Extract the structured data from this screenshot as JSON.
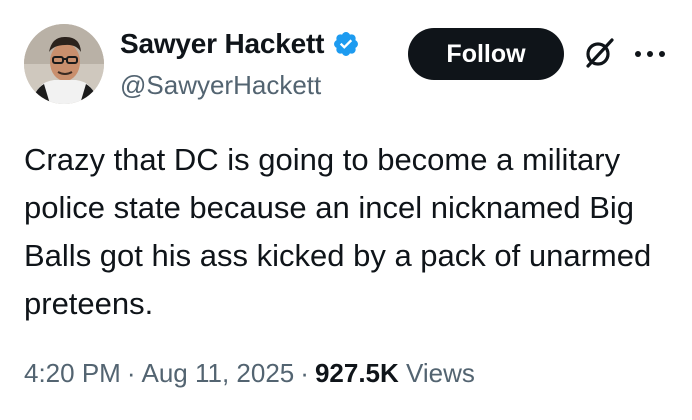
{
  "author": {
    "display_name": "Sawyer Hackett",
    "handle": "@SawyerHackett",
    "verified": true
  },
  "actions": {
    "follow_label": "Follow"
  },
  "icons": {
    "verified": "verified-badge-icon",
    "grok": "grok-icon",
    "more": "more-options-icon"
  },
  "tweet": {
    "text": "Crazy that DC is going to become a military police state because an incel nicknamed Big Balls got his ass kicked by a pack of unarmed preteens."
  },
  "meta": {
    "time": "4:20 PM",
    "separator": "·",
    "date": "Aug 11, 2025",
    "views_count": "927.5K",
    "views_label": "Views"
  },
  "colors": {
    "text_primary": "#0f1419",
    "text_secondary": "#536471",
    "verified_blue": "#1d9bf0",
    "follow_bg": "#0f1419",
    "follow_text": "#ffffff"
  }
}
